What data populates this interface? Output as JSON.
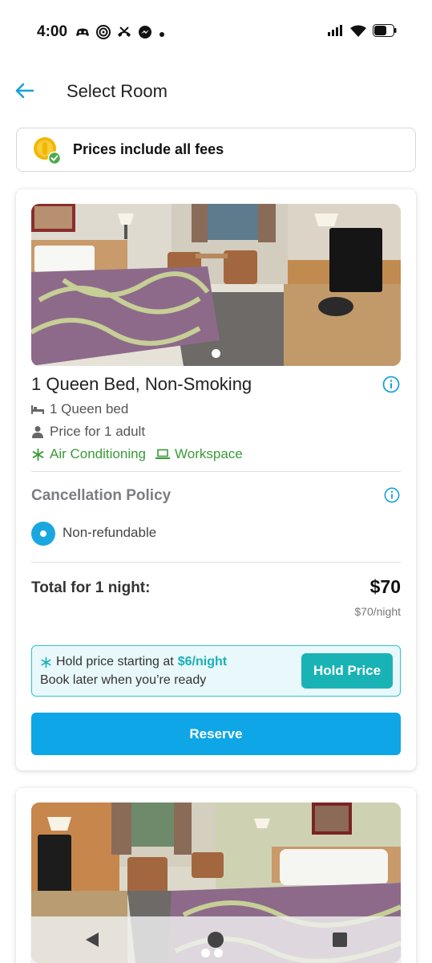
{
  "status_bar": {
    "time": "4:00"
  },
  "header": {
    "title": "Select Room"
  },
  "fee_banner": {
    "text": "Prices include all fees"
  },
  "room": {
    "title": "1 Queen Bed, Non-Smoking",
    "bed": "1 Queen bed",
    "occupancy": "Price for 1 adult",
    "amenities": [
      "Air Conditioning",
      "Workspace"
    ],
    "cancellation_title": "Cancellation Policy",
    "cancellation_option": "Non-refundable",
    "total_label": "Total for 1 night:",
    "total_price": "$70",
    "per_night": "$70/night",
    "hold": {
      "line1_prefix": "Hold price starting at",
      "line1_price": "$6/night",
      "line2": "Book later when you’re ready",
      "button": "Hold Price"
    },
    "reserve_label": "Reserve"
  },
  "colors": {
    "accent": "#0ea6e6",
    "teal": "#19b3b5",
    "amenity_green": "#3a9b38"
  },
  "icons": [
    "back-arrow-icon",
    "coin-check-icon",
    "info-icon",
    "bed-icon",
    "person-icon",
    "snowflake-icon",
    "laptop-icon"
  ]
}
